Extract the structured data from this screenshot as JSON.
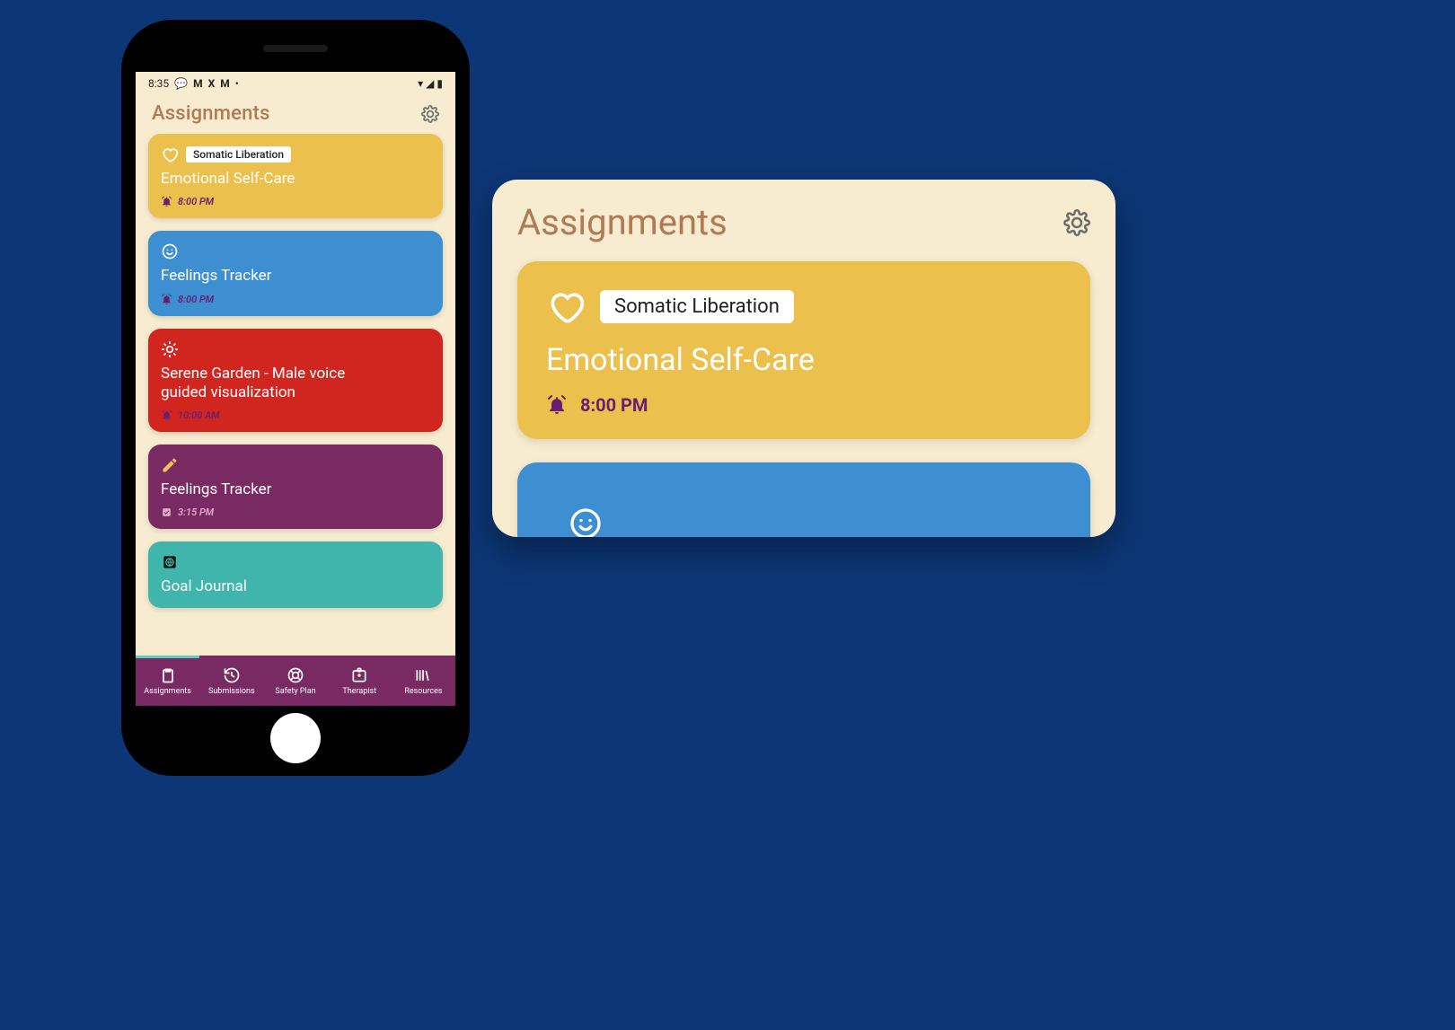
{
  "statusbar": {
    "time": "8:35"
  },
  "header": {
    "title": "Assignments"
  },
  "cards": [
    {
      "icon": "heart",
      "badge": "Somatic Liberation",
      "title": "Emotional Self-Care",
      "time": "8:00 PM",
      "timeIcon": "bell"
    },
    {
      "icon": "smile",
      "badge": null,
      "title": "Feelings Tracker",
      "time": "8:00 PM",
      "timeIcon": "bell"
    },
    {
      "icon": "sun",
      "badge": null,
      "title": "Serene Garden - Male voice guided visualization",
      "time": "10:00 AM",
      "timeIcon": "bell"
    },
    {
      "icon": "pencil",
      "badge": null,
      "title": "Feelings Tracker",
      "time": "3:15 PM",
      "timeIcon": "check"
    },
    {
      "icon": "globe",
      "badge": null,
      "title": "Goal Journal",
      "time": "",
      "timeIcon": ""
    }
  ],
  "nav": [
    {
      "label": "Assignments"
    },
    {
      "label": "Submissions"
    },
    {
      "label": "Safety Plan"
    },
    {
      "label": "Therapist"
    },
    {
      "label": "Resources"
    }
  ],
  "detail": {
    "title": "Assignments",
    "card": {
      "badge": "Somatic Liberation",
      "title": "Emotional Self-Care",
      "time": "8:00 PM"
    }
  }
}
